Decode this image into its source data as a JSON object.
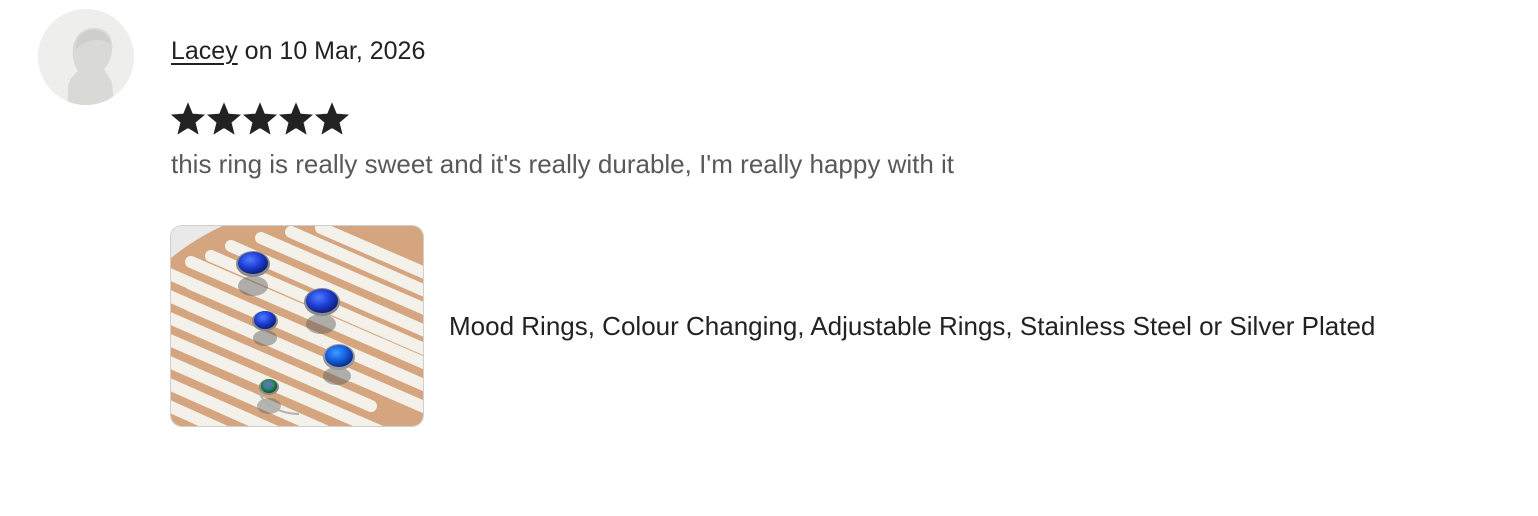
{
  "review": {
    "reviewer_name": "Lacey",
    "date_prefix": " on ",
    "date": "10 Mar, 2026",
    "rating": 5,
    "rating_max": 5,
    "text": "this ring is really sweet and it's really durable, I'm really happy with it",
    "item": {
      "title": "Mood Rings, Colour Changing, Adjustable Rings, Stainless Steel or Silver Plated",
      "thumbnail_icon": "mood-rings-photo"
    }
  },
  "colors": {
    "text_primary": "#222222",
    "text_secondary": "#595959",
    "avatar_bg": "#eeeeec",
    "star": "#222222"
  }
}
